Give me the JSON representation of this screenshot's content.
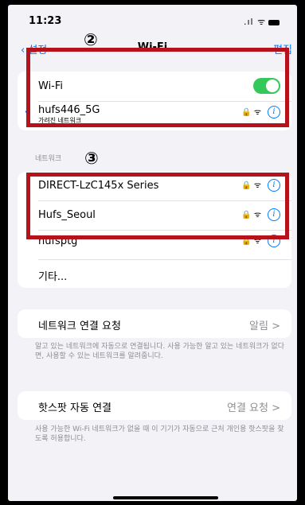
{
  "status": {
    "time": "11:23",
    "icons": ".ıl ᯤ"
  },
  "nav": {
    "back_label": "설정",
    "title": "Wi-Fi",
    "edit_label": "편집"
  },
  "annotations": {
    "marker_2": "②",
    "marker_3": "③"
  },
  "current": {
    "wifi_label": "Wi-Fi",
    "wifi_on": true,
    "connected_network": "hufs446_5G",
    "connected_sublabel": "가려진 네트워크"
  },
  "networks_header": "네트워크",
  "networks": [
    {
      "name": "DIRECT-LzC145x Series"
    },
    {
      "name": "Hufs_Seoul"
    },
    {
      "name": "hufsptg"
    }
  ],
  "other_label": "기타...",
  "ask_to_join": {
    "label": "네트워크 연결 요청",
    "value": "알림 >",
    "footnote": "알고 있는 네트워크에 자동으로 연결됩니다. 사용 가능한 알고 있는 네트워크가 없다면, 사용할 수 있는 네트워크를 알려줍니다."
  },
  "hotspot": {
    "label": "핫스팟 자동 연결",
    "value": "연결 요청 >",
    "footnote": "사용 가능한 Wi-Fi 네트워크가 없을 때 이 기기가 자동으로 근처 개인용 핫스팟을 찾도록 허용합니다."
  },
  "colors": {
    "accent": "#007aff",
    "toggle_on": "#34c759",
    "highlight_border": "#b5121b"
  }
}
